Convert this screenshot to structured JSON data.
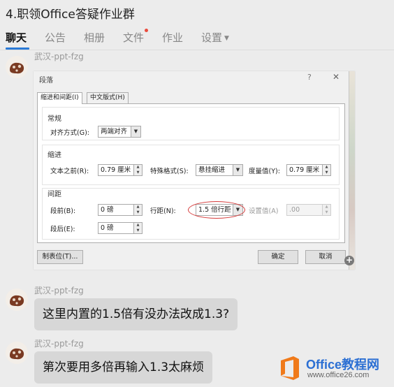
{
  "window": {
    "title": "4.职领Office答疑作业群"
  },
  "tabs": [
    {
      "label": "聊天"
    },
    {
      "label": "公告"
    },
    {
      "label": "相册"
    },
    {
      "label": "文件"
    },
    {
      "label": "作业"
    },
    {
      "label": "设置"
    }
  ],
  "messages": [
    {
      "sender": "武汉-ppt-fzg"
    },
    {
      "sender": "武汉-ppt-fzg",
      "text": "这里内置的1.5倍有没办法改成1.3?"
    },
    {
      "sender": "武汉-ppt-fzg",
      "text": "第次要用多倍再输入1.3太麻烦"
    }
  ],
  "dialog": {
    "title": "段落",
    "help": "?",
    "close": "✕",
    "tabs": [
      "缩进和间距(I)",
      "中文版式(H)"
    ],
    "general": {
      "title": "常规",
      "alignment_label": "对齐方式(G):",
      "alignment_value": "两端对齐"
    },
    "indent": {
      "title": "缩进",
      "before_label": "文本之前(R):",
      "before_value": "0.79 厘米",
      "special_label": "特殊格式(S):",
      "special_value": "悬挂缩进",
      "by_label": "度量值(Y):",
      "by_value": "0.79 厘米"
    },
    "spacing": {
      "title": "间距",
      "before_label": "段前(B):",
      "before_value": "0 磅",
      "after_label": "段后(E):",
      "after_value": "0 磅",
      "line_label": "行距(N):",
      "line_value": "1.5 倍行距",
      "at_label": "设置值(A)",
      "at_value": ".00"
    },
    "buttons": {
      "tabs": "制表位(T)...",
      "ok": "确定",
      "cancel": "取消"
    }
  },
  "watermark": {
    "brand": "Office教程网",
    "url": "www.office26.com"
  },
  "colors": {
    "accent": "#2a7ad6",
    "badge": "#e94b3c",
    "bubble": "#d7d7d7",
    "highlight": "#d63b3b",
    "watermark_orange": "#f07a1a"
  }
}
